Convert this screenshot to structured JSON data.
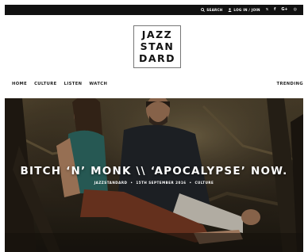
{
  "topbar": {
    "search_label": "SEARCH",
    "login_label": "LOG IN / JOIN",
    "social": [
      {
        "icon": "twitter-icon",
        "glyph": "𝕩"
      },
      {
        "icon": "facebook-icon",
        "glyph": "f"
      },
      {
        "icon": "google-plus-icon",
        "glyph": "G+"
      },
      {
        "icon": "instagram-icon",
        "glyph": "◎"
      }
    ]
  },
  "logo": {
    "line1": "JAZZ",
    "line2": "STAN",
    "line3": "DARD"
  },
  "nav": {
    "items": [
      "HOME",
      "CULTURE",
      "LISTEN",
      "WATCH"
    ],
    "trending": "TRENDING"
  },
  "hero": {
    "title": "BITCH ‘N’ MONK \\\\ ‘APOCALYPSE’ NOW.",
    "author": "JAZZSTANDARD",
    "date": "15TH SEPTEMBER 2016",
    "category": "CULTURE",
    "separator": "•"
  },
  "colors": {
    "topbar_bg": "#111111",
    "text": "#222222",
    "hero_text": "#ffffff"
  }
}
